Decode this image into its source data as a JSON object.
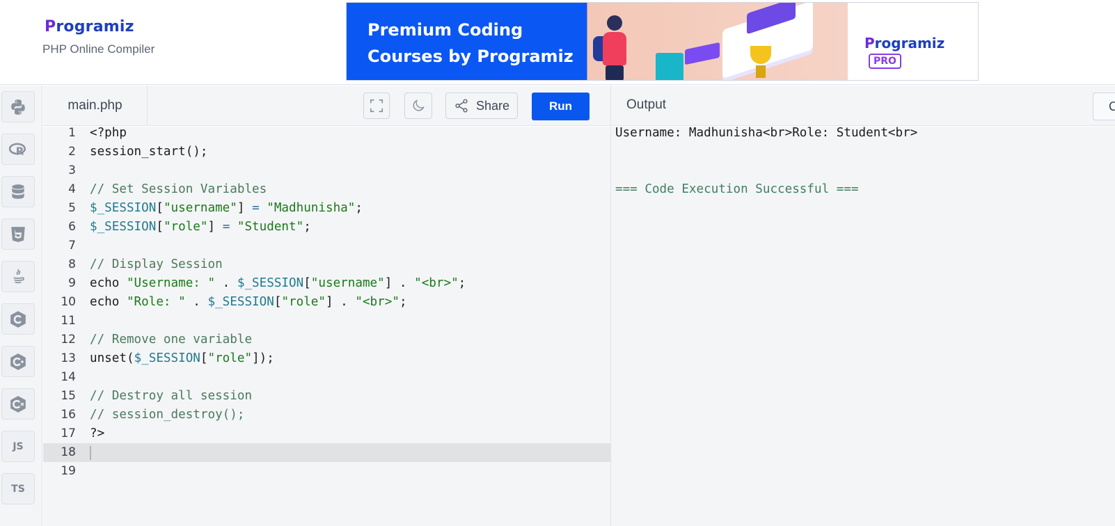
{
  "header": {
    "logo_text": "Programiz",
    "subtitle": "PHP Online Compiler",
    "banner": {
      "title_line1": "Premium Coding",
      "title_line2": "Courses by Programiz",
      "brand_text": "Programiz",
      "brand_badge": "PRO"
    }
  },
  "sidebar": {
    "languages": [
      {
        "name": "python-icon"
      },
      {
        "name": "r-icon"
      },
      {
        "name": "sql-icon"
      },
      {
        "name": "html5-icon"
      },
      {
        "name": "java-icon"
      },
      {
        "name": "c-icon"
      },
      {
        "name": "cpp-icon"
      },
      {
        "name": "csharp-icon"
      },
      {
        "name": "js-icon",
        "label": "JS"
      },
      {
        "name": "ts-icon",
        "label": "TS"
      }
    ]
  },
  "toolbar": {
    "file_tab": "main.php",
    "share_label": "Share",
    "run_label": "Run"
  },
  "editor": {
    "active_line": 18,
    "line_numbers": [
      "1",
      "2",
      "3",
      "4",
      "5",
      "6",
      "7",
      "8",
      "9",
      "10",
      "11",
      "12",
      "13",
      "14",
      "15",
      "16",
      "17",
      "18",
      "19"
    ],
    "lines": [
      "<?php",
      "session_start();",
      "",
      "// Set Session Variables",
      "$_SESSION[\"username\"] = \"Madhunisha\";",
      "$_SESSION[\"role\"] = \"Student\";",
      "",
      "// Display Session",
      "echo \"Username: \" . $_SESSION[\"username\"] . \"<br>\";",
      "echo \"Role: \" . $_SESSION[\"role\"] . \"<br>\";",
      "",
      "// Remove one variable",
      "unset($_SESSION[\"role\"]);",
      "",
      "// Destroy all session",
      "// session_destroy();",
      "?>",
      "",
      ""
    ]
  },
  "output": {
    "title": "Output",
    "clear_label": "Clear",
    "lines": [
      "Username: Madhunisha<br>Role: Student<br>",
      "",
      "",
      "=== Code Execution Successful ==="
    ]
  },
  "colors": {
    "run_button": "#0a57f0",
    "banner_blue": "#0b57f3",
    "brand_blue": "#1e3fbf",
    "brand_purple": "#6c2bd9"
  }
}
